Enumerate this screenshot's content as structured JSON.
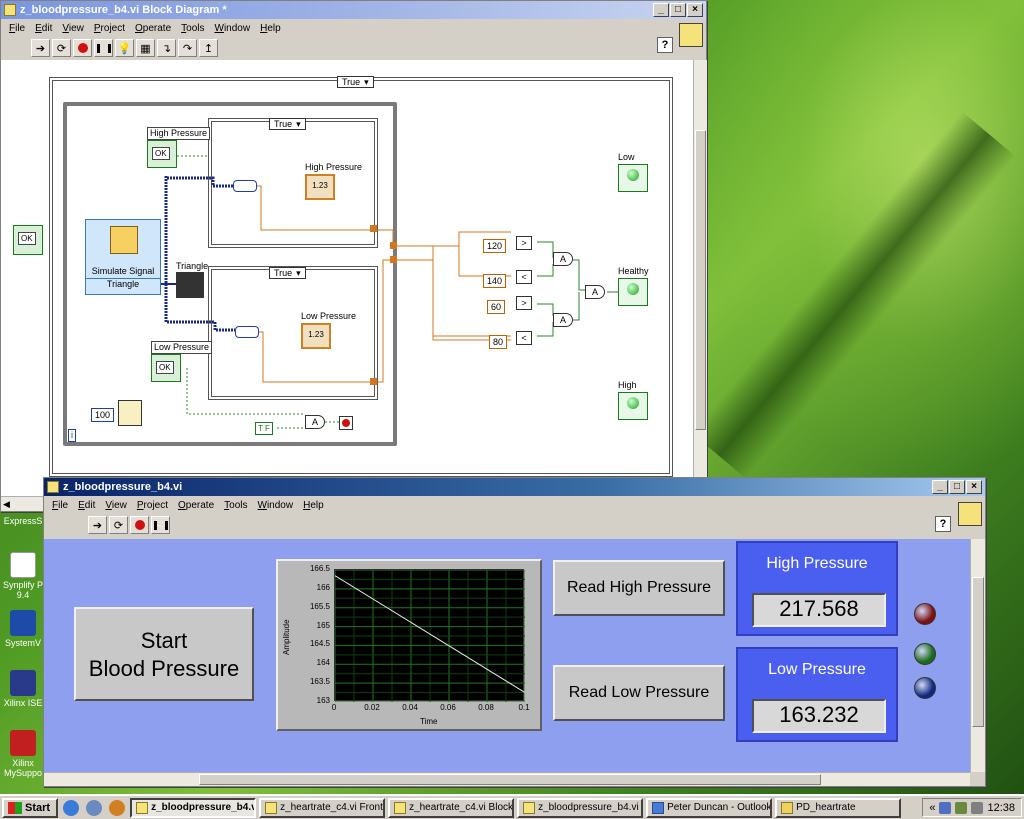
{
  "desktop": {
    "icons": [
      {
        "label": "ExpressS",
        "icon": "expresss-icon"
      },
      {
        "label": "Synplify P 9.4",
        "icon": "synplify-icon"
      },
      {
        "label": "SystemV",
        "icon": "systemv-icon"
      },
      {
        "label": "Xilinx ISE",
        "icon": "xilinx-ise-icon"
      },
      {
        "label": "Xilinx MySuppo",
        "icon": "xilinx-support-icon"
      }
    ]
  },
  "block_diagram": {
    "title": "z_bloodpressure_b4.vi Block Diagram *",
    "menu": [
      "File",
      "Edit",
      "View",
      "Project",
      "Operate",
      "Tools",
      "Window",
      "Help"
    ],
    "outer_case_selector": "True",
    "top_case_selector": "True",
    "bottom_case_selector": "True",
    "nodes": {
      "high_pressure_button": "High Pressure",
      "low_pressure_button": "Low Pressure",
      "high_pressure_indicator": "High Pressure",
      "low_pressure_indicator": "Low Pressure",
      "simulate_signal": "Simulate Signal",
      "signal_type": "Triangle",
      "triangle_graph": "Triangle",
      "ok_label": "OK",
      "wait_constant": "100",
      "num_indicator": "1.23",
      "info_icon": "i",
      "tf_const": "T F"
    },
    "comparisons": [
      {
        "constant": "120",
        "op": ">"
      },
      {
        "constant": "140",
        "op": "<"
      },
      {
        "constant": "60",
        "op": ">"
      },
      {
        "constant": "80",
        "op": "<"
      }
    ],
    "and_label": "A",
    "outputs": [
      "Low",
      "Healthy",
      "High"
    ]
  },
  "front_panel": {
    "title": "z_bloodpressure_b4.vi",
    "menu": [
      "File",
      "Edit",
      "View",
      "Project",
      "Operate",
      "Tools",
      "Window",
      "Help"
    ],
    "start_button": "Start\nBlood Pressure",
    "read_high_button": "Read High Pressure",
    "read_low_button": "Read Low Pressure",
    "high_pressure": {
      "label": "High Pressure",
      "value": "217.568"
    },
    "low_pressure": {
      "label": "Low Pressure",
      "value": "163.232"
    },
    "leds": [
      {
        "name": "Low",
        "color": "#7a1010"
      },
      {
        "name": "Healthy",
        "color": "#1a6a1a"
      },
      {
        "name": "High",
        "color": "#102a7a"
      }
    ],
    "help_label": "?"
  },
  "chart_data": {
    "type": "line",
    "title": "",
    "xlabel": "Time",
    "ylabel": "Amplitude",
    "xlim": [
      0,
      0.1
    ],
    "ylim": [
      163,
      166.5
    ],
    "x_ticks": [
      "0",
      "0.02",
      "0.04",
      "0.06",
      "0.08",
      "0.1"
    ],
    "y_ticks": [
      "163",
      "163.5",
      "164",
      "164.5",
      "165",
      "165.5",
      "166",
      "166.5"
    ],
    "grid": true,
    "series": [
      {
        "x": [
          0,
          0.1
        ],
        "y": [
          166.35,
          163.25
        ],
        "color": "#e8e8e8"
      }
    ]
  },
  "taskbar": {
    "start": "Start",
    "items": [
      {
        "label": "z_bloodpressure_b4.vi",
        "active": true
      },
      {
        "label": "z_heartrate_c4.vi Front ...",
        "active": false
      },
      {
        "label": "z_heartrate_c4.vi Block ...",
        "active": false
      },
      {
        "label": "z_bloodpressure_b4.vi Bl...",
        "active": false
      },
      {
        "label": "Peter Duncan - Outlook ...",
        "active": false
      },
      {
        "label": "PD_heartrate",
        "active": false
      }
    ],
    "clock": "12:38",
    "tray_chevron": "«"
  }
}
